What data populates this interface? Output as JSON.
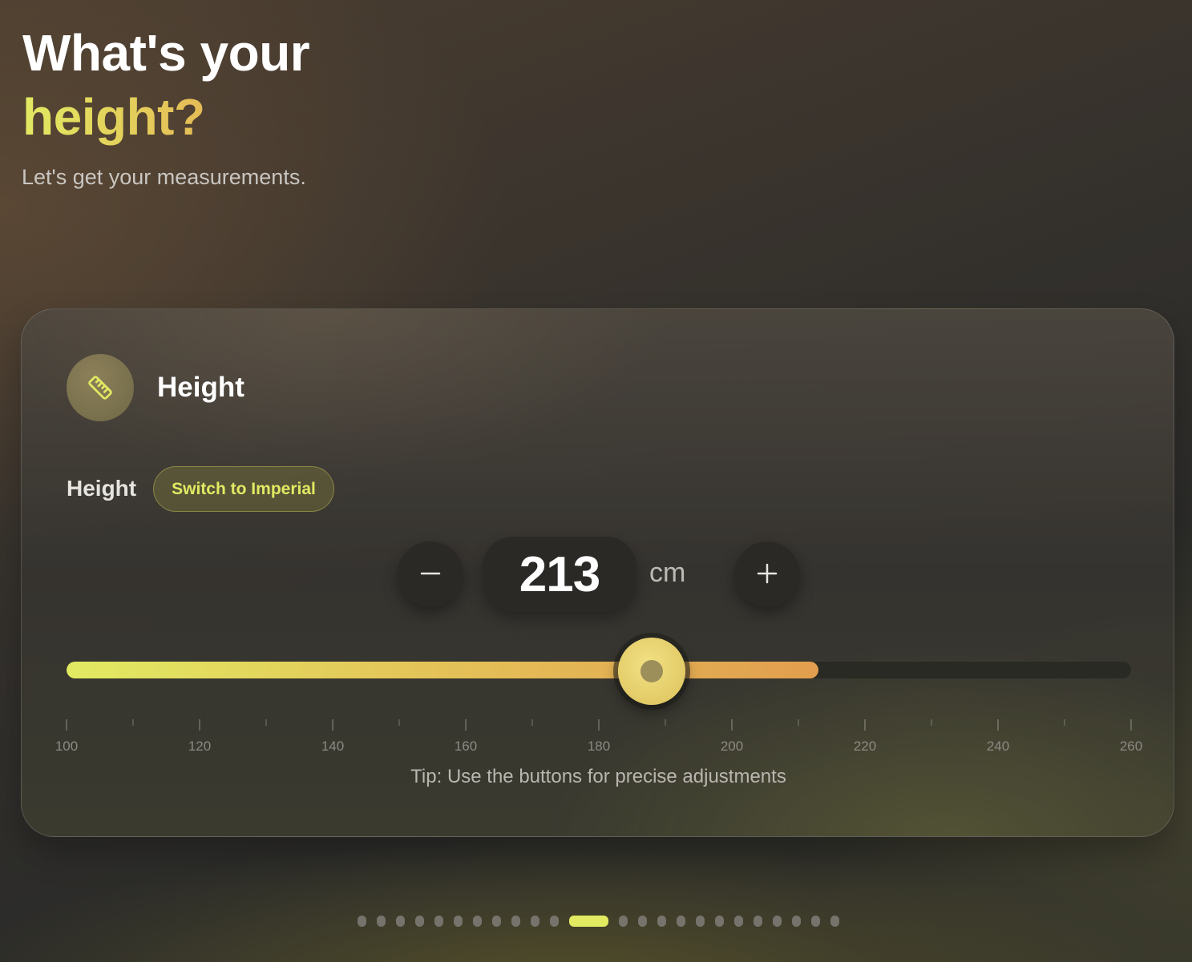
{
  "header": {
    "title_line1": "What's your",
    "title_line2": "height?",
    "subtitle": "Let's get your measurements."
  },
  "card": {
    "icon": "ruler-icon",
    "title": "Height",
    "field_label": "Height",
    "unit_toggle_label": "Switch to Imperial",
    "value": "213",
    "unit": "cm",
    "decrement_icon": "minus-icon",
    "increment_icon": "plus-icon",
    "tip": "Tip: Use the buttons for precise adjustments"
  },
  "slider": {
    "min": 100,
    "max": 260,
    "value": 213,
    "thumb_value": 188,
    "major_tick_step": 20,
    "minor_tick_step": 10,
    "tick_labels": [
      "100",
      "120",
      "140",
      "160",
      "180",
      "200",
      "220",
      "240",
      "260"
    ]
  },
  "pagination": {
    "total_steps": 24,
    "active_step": 11
  },
  "colors": {
    "accent_yellow": "#e2ea62",
    "accent_gold": "#e4c258",
    "accent_orange": "#e29e4e",
    "dark_surface": "#2a2926"
  }
}
